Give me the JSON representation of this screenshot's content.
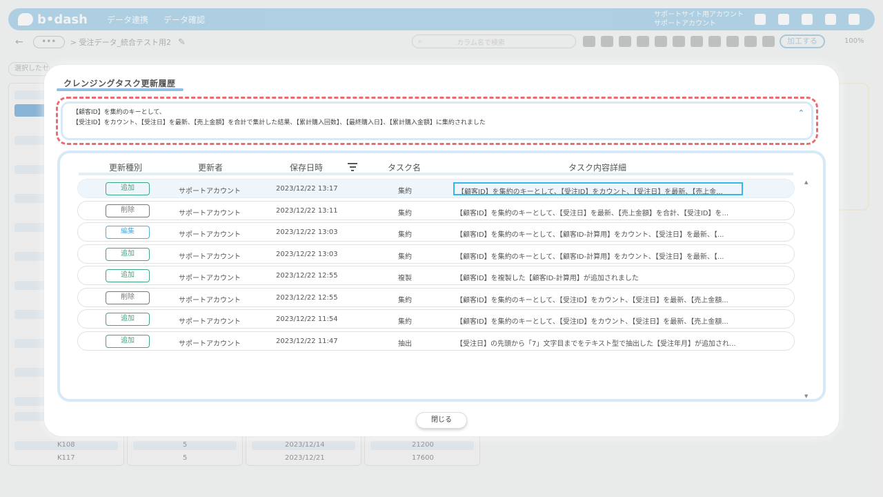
{
  "app": {
    "logo": "b•dash",
    "nav": [
      "データ連携",
      "データ確認"
    ],
    "account_lines": [
      "サポートサイト用アカウント",
      "サポートアカウント"
    ],
    "breadcrumb_dots": "•••",
    "breadcrumb": "> 受注データ_統合テスト用2",
    "search_placeholder": "カラム名で検索",
    "process_button": "加工する",
    "zoom": "100%",
    "select_placeholder": "選択したセ",
    "bottom_rows": [
      {
        "id": "K108",
        "count": "5",
        "date": "2023/12/14",
        "amount": "21200"
      },
      {
        "id": "K117",
        "count": "5",
        "date": "2023/12/21",
        "amount": "17600"
      }
    ]
  },
  "modal": {
    "title": "クレンジングタスク更新履歴",
    "summary_lines": [
      "【顧客ID】を集約のキーとして、",
      "【受注ID】をカウント、【受注日】を最新、【売上金額】を合計で集計した結果、【累計購入回数】、【最終購入日】、【累計購入金額】に集約されました"
    ],
    "collapse_glyph": "⌃",
    "headers": {
      "type": "更新種別",
      "user": "更新者",
      "saved_at": "保存日時",
      "task": "タスク名",
      "detail": "タスク内容詳細"
    },
    "rows": [
      {
        "type": "追加",
        "kind": "add",
        "user": "サポートアカウント",
        "date": "2023/12/22 13:17",
        "task": "集約",
        "detail": "【顧客ID】を集約のキーとして、【受注ID】をカウント、【受注日】を最新、【売上金..."
      },
      {
        "type": "削除",
        "kind": "del",
        "user": "サポートアカウント",
        "date": "2023/12/22 13:11",
        "task": "集約",
        "detail": "【顧客ID】を集約のキーとして、【受注日】を最新、【売上金額】を合計、【受注ID】を..."
      },
      {
        "type": "編集",
        "kind": "edit",
        "user": "サポートアカウント",
        "date": "2023/12/22 13:03",
        "task": "集約",
        "detail": "【顧客ID】を集約のキーとして、【顧客ID-計算用】をカウント、【受注日】を最新、【..."
      },
      {
        "type": "追加",
        "kind": "add",
        "user": "サポートアカウント",
        "date": "2023/12/22 13:03",
        "task": "集約",
        "detail": "【顧客ID】を集約のキーとして、【顧客ID-計算用】をカウント、【受注日】を最新、【..."
      },
      {
        "type": "追加",
        "kind": "add",
        "user": "サポートアカウント",
        "date": "2023/12/22 12:55",
        "task": "複製",
        "detail": "【顧客ID】を複製した【顧客ID-計算用】が追加されました"
      },
      {
        "type": "削除",
        "kind": "del",
        "user": "サポートアカウント",
        "date": "2023/12/22 12:55",
        "task": "集約",
        "detail": "【顧客ID】を集約のキーとして、【受注ID】をカウント、【受注日】を最新、【売上金額..."
      },
      {
        "type": "追加",
        "kind": "add",
        "user": "サポートアカウント",
        "date": "2023/12/22 11:54",
        "task": "集約",
        "detail": "【顧客ID】を集約のキーとして、【受注ID】をカウント、【受注日】を最新、【売上金額..."
      },
      {
        "type": "追加",
        "kind": "add",
        "user": "サポートアカウント",
        "date": "2023/12/22 11:47",
        "task": "抽出",
        "detail": "【受注日】の先頭から「7」文字目までをテキスト型で抽出した【受注年月】が追加され..."
      }
    ],
    "close_label": "閉じる"
  }
}
